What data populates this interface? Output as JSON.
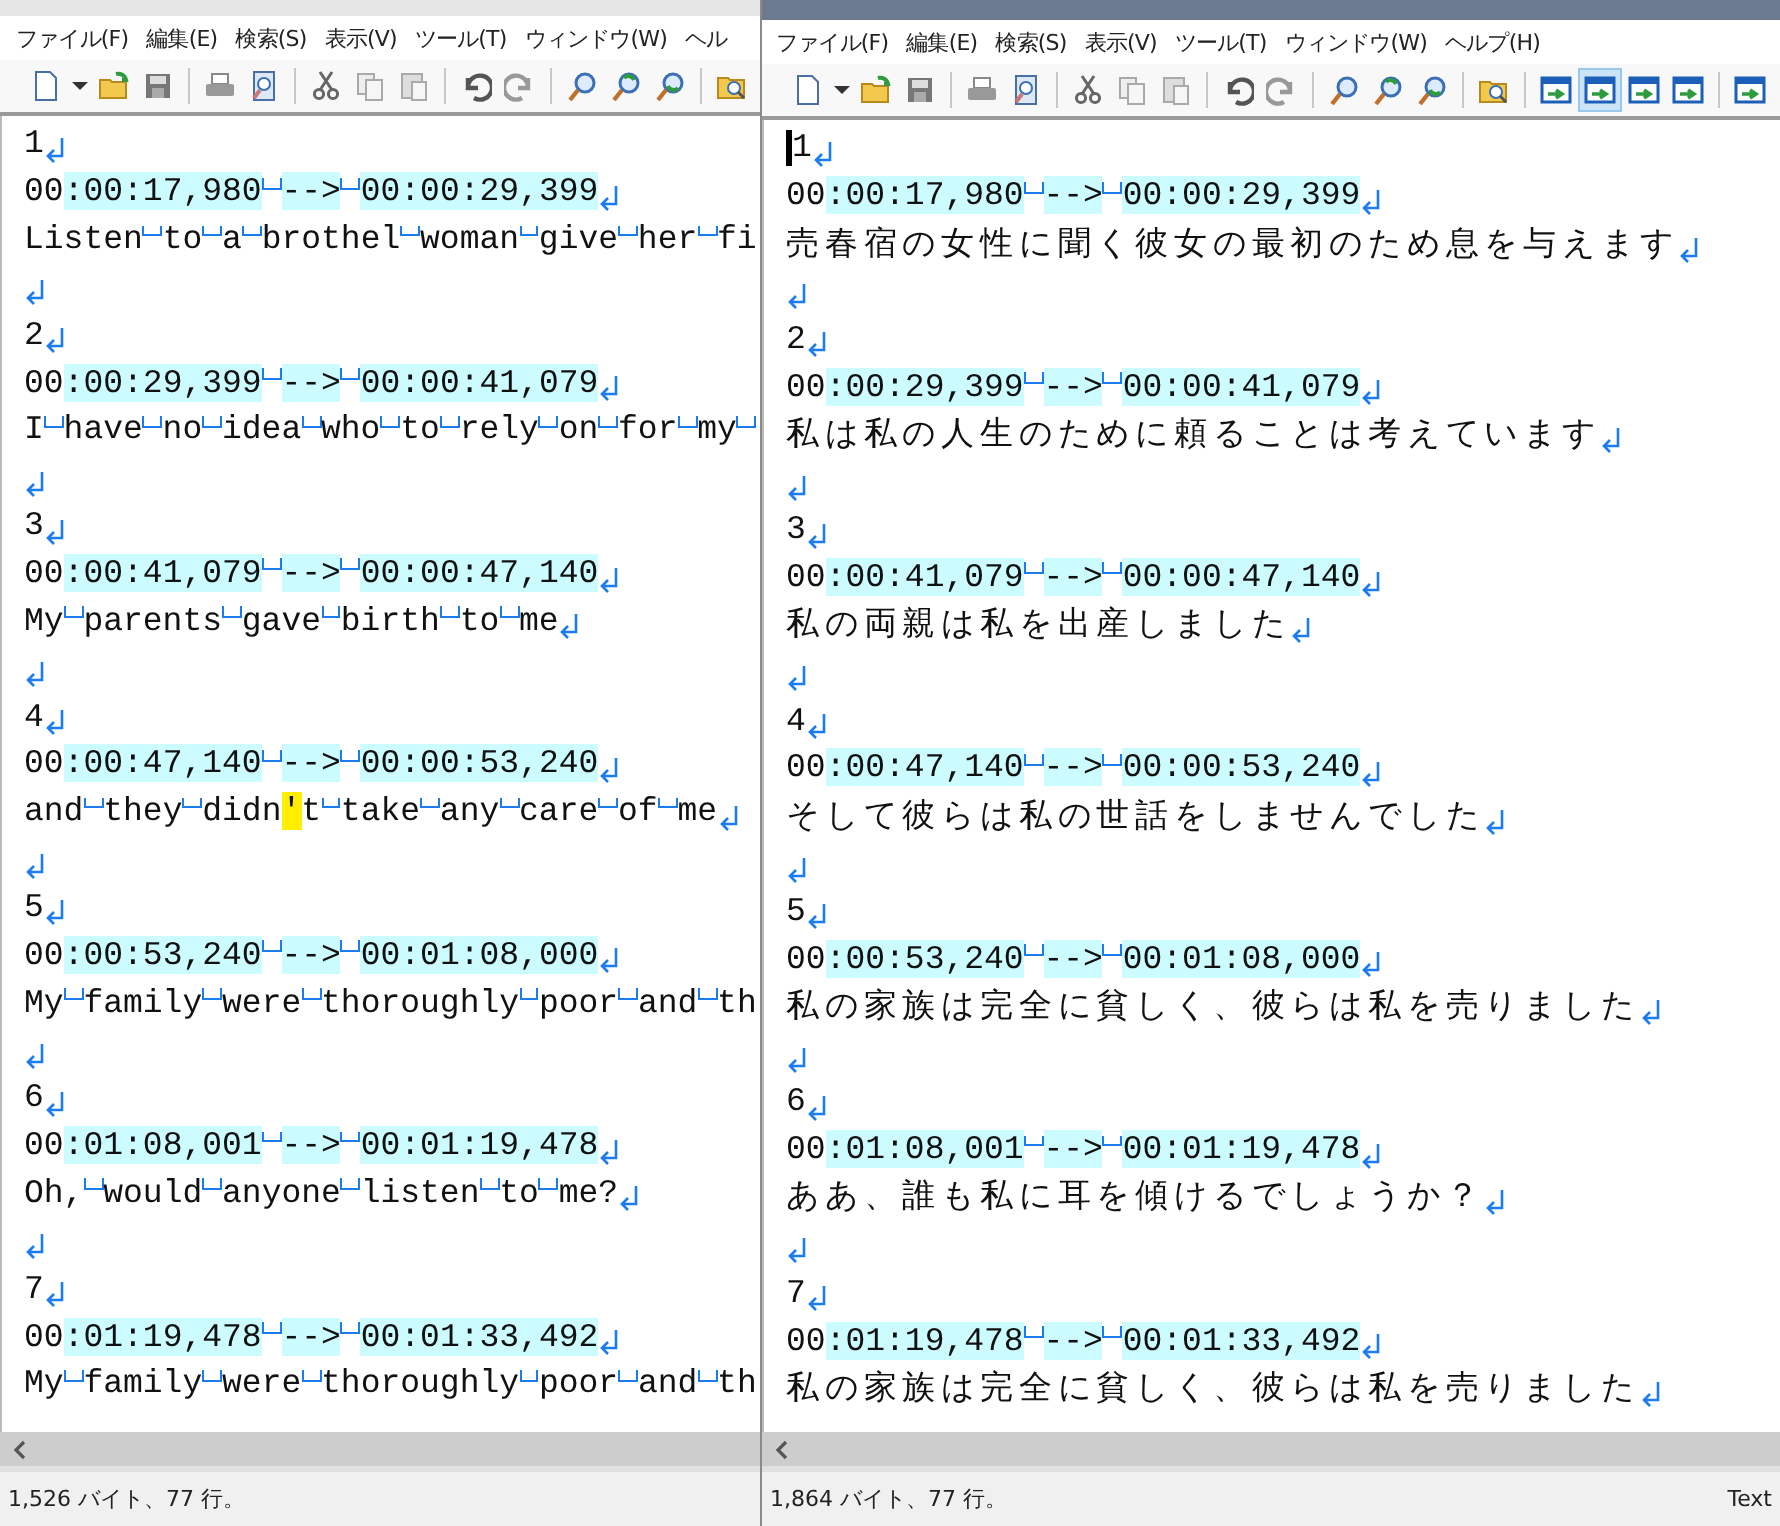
{
  "windows": [
    {
      "menu": [
        "ファイル(F)",
        "編集(E)",
        "検索(S)",
        "表示(V)",
        "ツール(T)",
        "ウィンドウ(W)",
        "ヘル"
      ],
      "toolbar": [
        {
          "kind": "new"
        },
        {
          "kind": "caret"
        },
        {
          "kind": "open"
        },
        {
          "kind": "save"
        },
        {
          "kind": "sep"
        },
        {
          "kind": "print"
        },
        {
          "kind": "preview"
        },
        {
          "kind": "sep"
        },
        {
          "kind": "cut"
        },
        {
          "kind": "copy"
        },
        {
          "kind": "paste"
        },
        {
          "kind": "sep"
        },
        {
          "kind": "undo"
        },
        {
          "kind": "redo"
        },
        {
          "kind": "sep"
        },
        {
          "kind": "find"
        },
        {
          "kind": "find-next"
        },
        {
          "kind": "find-prev"
        },
        {
          "kind": "sep"
        },
        {
          "kind": "grep"
        }
      ],
      "lines": [
        {
          "text": "1",
          "newline": true
        },
        {
          "parts": [
            {
              "text": "00"
            },
            {
              "text": ":00:17,980",
              "color": "#ccfcff",
              "space_after": true
            },
            {
              "text": "-->",
              "color": "#ccfcff",
              "space_after": true
            },
            {
              "text": "00:00:29,399",
              "color": "#ccfcff"
            }
          ],
          "newline": true
        },
        {
          "text": "Listen to a brothel woman give her fi",
          "newline": false
        },
        {
          "newline": true
        },
        {
          "text": "2",
          "newline": true
        },
        {
          "parts": [
            {
              "text": "00"
            },
            {
              "text": ":00:29,399",
              "color": "#ccfcff",
              "space_after": true
            },
            {
              "text": "-->",
              "color": "#ccfcff",
              "space_after": true
            },
            {
              "text": "00:00:41,079",
              "color": "#ccfcff"
            }
          ],
          "newline": true
        },
        {
          "text": "I have no idea who to rely on for my ",
          "newline": false
        },
        {
          "newline": true
        },
        {
          "text": "3",
          "newline": true
        },
        {
          "parts": [
            {
              "text": "00"
            },
            {
              "text": ":00:41,079",
              "color": "#ccfcff",
              "space_after": true
            },
            {
              "text": "-->",
              "color": "#ccfcff",
              "space_after": true
            },
            {
              "text": "00:00:47,140",
              "color": "#ccfcff"
            }
          ],
          "newline": true
        },
        {
          "text": "My parents gave birth to me",
          "newline": true
        },
        {
          "newline": true
        },
        {
          "text": "4",
          "newline": true
        },
        {
          "parts": [
            {
              "text": "00"
            },
            {
              "text": ":00:47,140",
              "color": "#ccfcff",
              "space_after": true
            },
            {
              "text": "-->",
              "color": "#ccfcff",
              "space_after": true
            },
            {
              "text": "00:00:53,240",
              "color": "#ccfcff"
            }
          ],
          "newline": true
        },
        {
          "parts": [
            {
              "text": "and they didn"
            },
            {
              "text": "'",
              "color": "#ffee00"
            },
            {
              "text": "t take any care of me"
            }
          ],
          "newline": true
        },
        {
          "newline": true
        },
        {
          "text": "5",
          "newline": true
        },
        {
          "parts": [
            {
              "text": "00"
            },
            {
              "text": ":00:53,240",
              "color": "#ccfcff",
              "space_after": true
            },
            {
              "text": "-->",
              "color": "#ccfcff",
              "space_after": true
            },
            {
              "text": "00:01:08,000",
              "color": "#ccfcff"
            }
          ],
          "newline": true
        },
        {
          "text": "My family were thoroughly poor and th",
          "newline": false
        },
        {
          "newline": true
        },
        {
          "text": "6",
          "newline": true
        },
        {
          "parts": [
            {
              "text": "00"
            },
            {
              "text": ":01:08,001",
              "color": "#ccfcff",
              "space_after": true
            },
            {
              "text": "-->",
              "color": "#ccfcff",
              "space_after": true
            },
            {
              "text": "00:01:19,478",
              "color": "#ccfcff"
            }
          ],
          "newline": true
        },
        {
          "text": "Oh, would anyone listen to me?",
          "newline": true
        },
        {
          "newline": true
        },
        {
          "text": "7",
          "newline": true
        },
        {
          "parts": [
            {
              "text": "00"
            },
            {
              "text": ":01:19,478",
              "color": "#ccfcff",
              "space_after": true
            },
            {
              "text": "-->",
              "color": "#ccfcff",
              "space_after": true
            },
            {
              "text": "00:01:33,492",
              "color": "#ccfcff"
            }
          ],
          "newline": true
        },
        {
          "text": "My family were thoroughly poor and th",
          "newline": false
        }
      ],
      "status": [
        "1,526 バイト、77 行。"
      ]
    },
    {
      "menu": [
        "ファイル(F)",
        "編集(E)",
        "検索(S)",
        "表示(V)",
        "ツール(T)",
        "ウィンドウ(W)",
        "ヘルプ(H)"
      ],
      "toolbar": [
        {
          "kind": "new"
        },
        {
          "kind": "caret"
        },
        {
          "kind": "open"
        },
        {
          "kind": "save"
        },
        {
          "kind": "sep"
        },
        {
          "kind": "print"
        },
        {
          "kind": "preview"
        },
        {
          "kind": "sep"
        },
        {
          "kind": "cut"
        },
        {
          "kind": "copy"
        },
        {
          "kind": "paste"
        },
        {
          "kind": "sep"
        },
        {
          "kind": "undo"
        },
        {
          "kind": "redo"
        },
        {
          "kind": "sep"
        },
        {
          "kind": "find"
        },
        {
          "kind": "find-next"
        },
        {
          "kind": "find-prev"
        },
        {
          "kind": "sep"
        },
        {
          "kind": "grep"
        }
      ],
      "toggles": [
        {
          "pressed": false
        },
        {
          "pressed": true
        },
        {
          "pressed": false
        },
        {
          "pressed": false
        }
      ],
      "extra_tools": [
        {
          "kind": "view"
        }
      ],
      "lines": [
        {
          "text": "1",
          "newline": true,
          "cursor": true
        },
        {
          "parts": [
            {
              "text": "00"
            },
            {
              "text": ":00:17,980",
              "color": "#ccfcff",
              "space_after": true
            },
            {
              "text": "-->",
              "color": "#ccfcff",
              "space_after": true
            },
            {
              "text": "00:00:29,399",
              "color": "#ccfcff"
            }
          ],
          "newline": true
        },
        {
          "text": "売春宿の女性に聞く彼女の最初のため息を与えます",
          "newline": true,
          "kind": "wide"
        },
        {
          "newline": true
        },
        {
          "text": "2",
          "newline": true
        },
        {
          "parts": [
            {
              "text": "00"
            },
            {
              "text": ":00:29,399",
              "color": "#ccfcff",
              "space_after": true
            },
            {
              "text": "-->",
              "color": "#ccfcff",
              "space_after": true
            },
            {
              "text": "00:00:41,079",
              "color": "#ccfcff"
            }
          ],
          "newline": true
        },
        {
          "text": "私は私の人生のために頼ることは考えています",
          "newline": true,
          "kind": "wide"
        },
        {
          "newline": true
        },
        {
          "text": "3",
          "newline": true
        },
        {
          "parts": [
            {
              "text": "00"
            },
            {
              "text": ":00:41,079",
              "color": "#ccfcff",
              "space_after": true
            },
            {
              "text": "-->",
              "color": "#ccfcff",
              "space_after": true
            },
            {
              "text": "00:00:47,140",
              "color": "#ccfcff"
            }
          ],
          "newline": true
        },
        {
          "text": "私の両親は私を出産しました",
          "newline": true,
          "kind": "wide"
        },
        {
          "newline": true
        },
        {
          "text": "4",
          "newline": true
        },
        {
          "parts": [
            {
              "text": "00"
            },
            {
              "text": ":00:47,140",
              "color": "#ccfcff",
              "space_after": true
            },
            {
              "text": "-->",
              "color": "#ccfcff",
              "space_after": true
            },
            {
              "text": "00:00:53,240",
              "color": "#ccfcff"
            }
          ],
          "newline": true
        },
        {
          "text": "そして彼らは私の世話をしませんでした",
          "newline": true,
          "kind": "wide"
        },
        {
          "newline": true
        },
        {
          "text": "5",
          "newline": true
        },
        {
          "parts": [
            {
              "text": "00"
            },
            {
              "text": ":00:53,240",
              "color": "#ccfcff",
              "space_after": true
            },
            {
              "text": "-->",
              "color": "#ccfcff",
              "space_after": true
            },
            {
              "text": "00:01:08,000",
              "color": "#ccfcff"
            }
          ],
          "newline": true
        },
        {
          "text": "私の家族は完全に貧しく、彼らは私を売りました",
          "newline": true,
          "kind": "wide"
        },
        {
          "newline": true
        },
        {
          "text": "6",
          "newline": true
        },
        {
          "parts": [
            {
              "text": "00"
            },
            {
              "text": ":01:08,001",
              "color": "#ccfcff",
              "space_after": true
            },
            {
              "text": "-->",
              "color": "#ccfcff",
              "space_after": true
            },
            {
              "text": "00:01:19,478",
              "color": "#ccfcff"
            }
          ],
          "newline": true
        },
        {
          "text": "ああ、誰も私に耳を傾けるでしょうか？",
          "newline": true,
          "kind": "wide"
        },
        {
          "newline": true
        },
        {
          "text": "7",
          "newline": true
        },
        {
          "parts": [
            {
              "text": "00"
            },
            {
              "text": ":01:19,478",
              "color": "#ccfcff",
              "space_after": true
            },
            {
              "text": "-->",
              "color": "#ccfcff",
              "space_after": true
            },
            {
              "text": "00:01:33,492",
              "color": "#ccfcff"
            }
          ],
          "newline": true
        },
        {
          "text": "私の家族は完全に貧しく、彼らは私を売りました",
          "newline": true,
          "kind": "wide"
        }
      ],
      "status": [
        "1,864 バイト、77 行。",
        "Text"
      ]
    }
  ]
}
